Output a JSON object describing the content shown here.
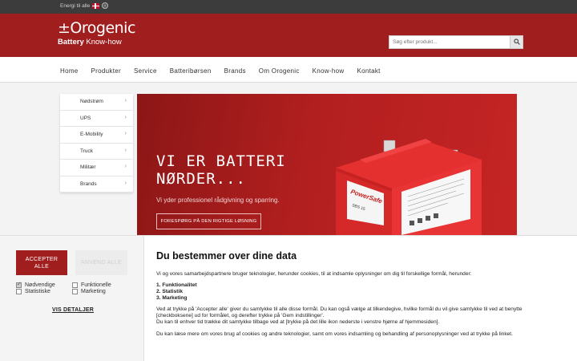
{
  "topbar": {
    "lang_text": "Energi til alle",
    "flag_icon": "danish-flag-icon",
    "globe_icon": "globe-icon"
  },
  "header": {
    "brand": "±Orogenic",
    "tagline_bold": "Battery",
    "tagline_rest": " Know-how",
    "search_placeholder": "Søg efter produkt..."
  },
  "nav": {
    "items": [
      "Home",
      "Produkter",
      "Service",
      "Batteribørsen",
      "Brands",
      "Om Orogenic",
      "Know-how",
      "Kontakt"
    ]
  },
  "sidemenu": {
    "items": [
      "Nødstrøm",
      "UPS",
      "E-Mobility",
      "Truck",
      "Militær",
      "Brands"
    ]
  },
  "hero": {
    "headline_line1": "VI ER BATTERI",
    "headline_line2": "NØRDER...",
    "subtitle": "Vi yder professionel rådgivning og sparring.",
    "cta": "FORESPØRG PÅ DEN RIGTIGE LØSNING",
    "battery_label_brand": "PowerSafe",
    "battery_label_model": "SBS 15"
  },
  "cookie": {
    "accept_line1": "ACCEPTER",
    "accept_line2": "ALLE",
    "apply_label": "ANVEND ALLE",
    "checks": [
      {
        "label": "Nødvendige",
        "checked": true
      },
      {
        "label": "Funktionelle",
        "checked": false
      },
      {
        "label": "Statistiske",
        "checked": false
      },
      {
        "label": "Marketing",
        "checked": false
      }
    ],
    "details_link": "VIS DETALJER",
    "title": "Du bestemmer over dine data",
    "intro": "Vi og vores samarbejdspartnere bruger teknologier, herunder cookies, til at indsamle oplysninger om dig til forskellige formål, herunder:",
    "purposes": [
      "1. Funktionalitet",
      "2. Statistik",
      "3. Marketing"
    ],
    "para2_a": "Ved at trykke på 'Accepter alle' giver du samtykke til alle disse formål. Du kan også vælge at tilkendegive, hvilke formål du vil give samtykke til ved at benytte [checkboksene] ud for formålet, og derefter trykke på 'Gem indstillinger'.",
    "para2_b": "Du kan til enhver tid trække dit samtykke tilbage ved at [trykke på det lille ikon nederste i venstre hjørne af hjemmesiden].",
    "para3": "Du kan læse mere om vores brug af cookies og andre teknologier, samt om vores indsamling og behandling af personoplysninger ved at trykke på linket."
  },
  "colors": {
    "brand_red": "#a11e1e",
    "topbar": "#3c3c3c",
    "hero_red": "#b21f1f"
  }
}
